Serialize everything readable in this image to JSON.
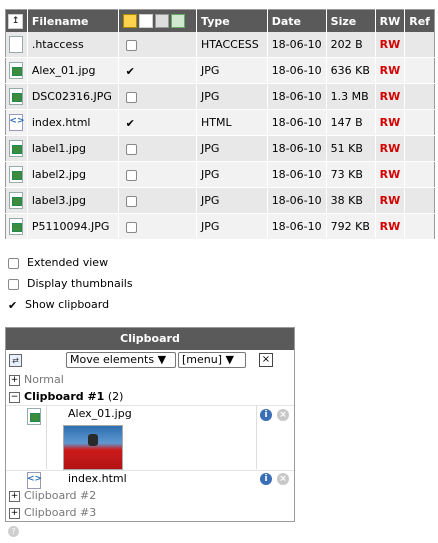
{
  "table": {
    "headers": {
      "filename": "Filename",
      "type": "Type",
      "date": "Date",
      "size": "Size",
      "rw": "RW",
      "ref": "Ref"
    },
    "rows": [
      {
        "name": ".htaccess",
        "icon": "blank-file-icon",
        "checked": false,
        "type": "HTACCESS",
        "date": "18-06-10",
        "size": "202 B",
        "rw": "RW"
      },
      {
        "name": "Alex_01.jpg",
        "icon": "image-file-icon",
        "checked": true,
        "type": "JPG",
        "date": "18-06-10",
        "size": "636 KB",
        "rw": "RW"
      },
      {
        "name": "DSC02316.JPG",
        "icon": "image-file-icon",
        "checked": false,
        "type": "JPG",
        "date": "18-06-10",
        "size": "1.3 MB",
        "rw": "RW"
      },
      {
        "name": "index.html",
        "icon": "html-file-icon",
        "checked": true,
        "type": "HTML",
        "date": "18-06-10",
        "size": "147 B",
        "rw": "RW"
      },
      {
        "name": "label1.jpg",
        "icon": "image-file-icon",
        "checked": false,
        "type": "JPG",
        "date": "18-06-10",
        "size": "51 KB",
        "rw": "RW"
      },
      {
        "name": "label2.jpg",
        "icon": "image-file-icon",
        "checked": false,
        "type": "JPG",
        "date": "18-06-10",
        "size": "73 KB",
        "rw": "RW"
      },
      {
        "name": "label3.jpg",
        "icon": "image-file-icon",
        "checked": false,
        "type": "JPG",
        "date": "18-06-10",
        "size": "38 KB",
        "rw": "RW"
      },
      {
        "name": "P5110094.JPG",
        "icon": "image-file-icon",
        "checked": false,
        "type": "JPG",
        "date": "18-06-10",
        "size": "792 KB",
        "rw": "RW"
      }
    ]
  },
  "options": {
    "extended_view": "Extended view",
    "display_thumbnails": "Display thumbnails",
    "show_clipboard": "Show clipboard",
    "extended_view_checked": false,
    "display_thumbnails_checked": false,
    "show_clipboard_checked": true
  },
  "clipboard": {
    "title": "Clipboard",
    "mode_select": "Move elements",
    "menu_select": "[menu]",
    "close_glyph": "×",
    "groups": {
      "normal": "Normal",
      "clipboard1": "Clipboard #1",
      "clipboard1_count": "(2)",
      "clipboard2": "Clipboard #2",
      "clipboard3": "Clipboard #3"
    },
    "items": [
      {
        "name": "Alex_01.jpg"
      },
      {
        "name": "index.html"
      }
    ]
  },
  "colors": {
    "header_bg": "#5a5a5a",
    "row_light": "#f2f2f2",
    "row_dark": "#e8e8e8",
    "rw_red": "#d40000",
    "info_blue": "#3a6fb8"
  }
}
